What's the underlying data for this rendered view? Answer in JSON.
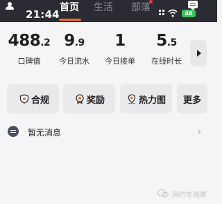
{
  "status_bar": {
    "time": "21:44",
    "battery": "48"
  },
  "nav": {
    "tabs": [
      {
        "label": "首页",
        "active": true
      },
      {
        "label": "生活",
        "active": false
      },
      {
        "label": "部落",
        "active": false,
        "has_badge": true
      }
    ],
    "active_color": "#ff6a1a"
  },
  "stats": {
    "items": [
      {
        "int": "488",
        "dec": ".2",
        "label": "口碑值"
      },
      {
        "int": "9",
        "dec": ".9",
        "label": "今日流水"
      },
      {
        "int": "1",
        "dec": "",
        "label": "今日接单"
      },
      {
        "int": "5",
        "dec": ".5",
        "label": "在线时长"
      }
    ]
  },
  "shortcuts": [
    {
      "label": "合规",
      "icon": "shield-icon"
    },
    {
      "label": "奖励",
      "icon": "medal-icon"
    },
    {
      "label": "热力图",
      "icon": "location-pin-icon"
    },
    {
      "label": "更多",
      "icon": ""
    }
  ],
  "message": {
    "text": "暂无消息",
    "icon": "chat-icon"
  },
  "watermark": {
    "text": "网约车观察"
  },
  "colors": {
    "header_bg": "#2b2c33",
    "accent": "#ff6a1a",
    "battery": "#3cc35a",
    "badge": "#ff3b3b",
    "page_bg": "#f5f5f7",
    "button_bg": "#e9e9ec"
  }
}
